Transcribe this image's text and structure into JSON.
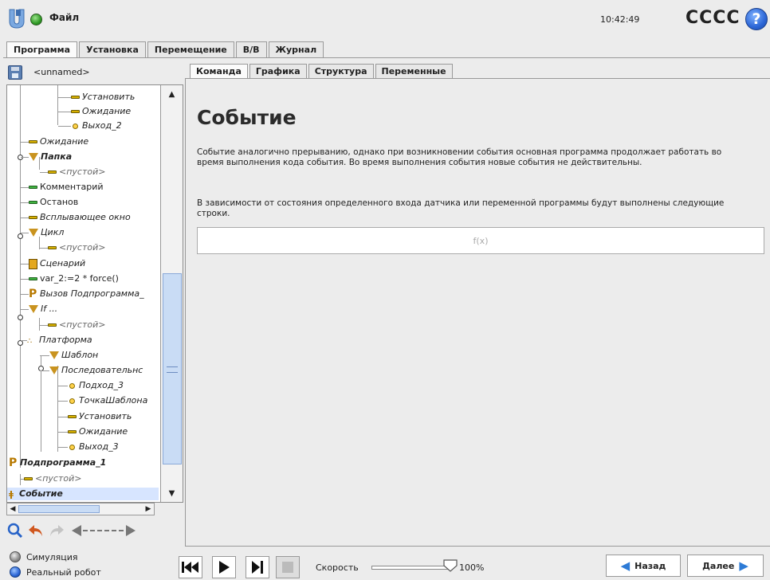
{
  "header": {
    "file_menu": "Файл",
    "clock": "10:42:49",
    "robot_name": "CCCC",
    "help_symbol": "?"
  },
  "main_tabs": [
    "Программа",
    "Установка",
    "Перемещение",
    "В/В",
    "Журнал"
  ],
  "main_tab_active": "Программа",
  "program": {
    "name": "<unnamed>"
  },
  "tree": [
    "Установить",
    "Ожидание",
    "Выход_2",
    "Ожидание",
    "Папка",
    "<пустой>",
    "Комментарий",
    "Останов",
    "Всплывающее окно",
    "Цикл",
    "<пустой>",
    "Сценарий",
    "var_2:=2 * force()",
    "Вызов Подпрограмма_",
    "If ...",
    "<пустой>",
    "Платформа",
    "Шаблон",
    "Последовательнс",
    "Подход_3",
    "ТочкаШаблона",
    "Установить",
    "Ожидание",
    "Выход_3",
    "Подпрограмма_1",
    "<пустой>",
    "Событие"
  ],
  "tree_selected": "Событие",
  "sub_tabs": [
    "Команда",
    "Графика",
    "Структура",
    "Переменные"
  ],
  "sub_tab_active": "Команда",
  "content": {
    "title": "Событие",
    "description_1": "Событие аналогично прерыванию, однако при возникновении события основная программа продолжает работать во время выполнения кода события. Во время выполнения события новые события не действительны.",
    "description_2": "В зависимости от состояния определенного входа датчика или переменной программы будут выполнены следующие строки.",
    "expression_placeholder": "f(x)"
  },
  "footer": {
    "mode_sim": "Симуляция",
    "mode_real": "Реальный робот",
    "speed_label": "Скорость",
    "speed_value": "100%",
    "speed_fraction": 1.0,
    "back_label": "Назад",
    "next_label": "Далее"
  },
  "colors": {
    "accent": "#2c66d6",
    "status_ok": "#2f9a25",
    "selection": "#d7e5ff"
  },
  "icons": [
    "ur-logo-icon",
    "status-ok-icon",
    "help-icon",
    "save-icon",
    "search-icon",
    "undo-icon",
    "redo-icon",
    "move-icon"
  ]
}
